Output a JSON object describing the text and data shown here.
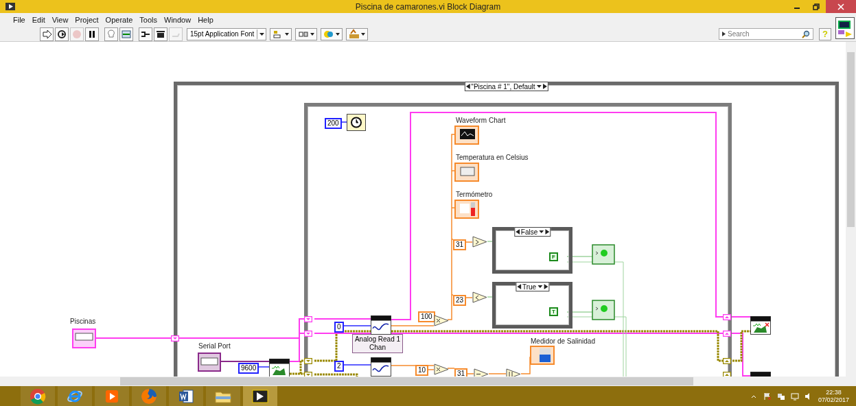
{
  "window": {
    "title": "Piscina de camarones.vi Block Diagram"
  },
  "menu": [
    "File",
    "Edit",
    "View",
    "Project",
    "Operate",
    "Tools",
    "Window",
    "Help"
  ],
  "toolbar": {
    "buttons": [
      {
        "kind": "run",
        "disabled": false
      },
      {
        "kind": "run_continuously",
        "disabled": false
      },
      {
        "kind": "abort",
        "disabled": true
      },
      {
        "kind": "pause",
        "disabled": false
      },
      {
        "kind": "highlight",
        "disabled": false
      },
      {
        "kind": "retain",
        "disabled": false
      },
      {
        "kind": "step_into",
        "disabled": false
      },
      {
        "kind": "step_over",
        "disabled": false
      },
      {
        "kind": "step_out",
        "disabled": true
      }
    ],
    "font": "15pt Application Font",
    "tools": [
      {
        "kind": "align"
      },
      {
        "kind": "distribute"
      },
      {
        "kind": "reorder"
      },
      {
        "kind": "cleanup"
      }
    ],
    "search": {
      "placeholder": "Search"
    },
    "help": "?"
  },
  "diagram": {
    "case_selector": "\"Piscina # 1\", Default",
    "labels": [
      "Waveform Chart",
      "Temperatura en Celsius",
      "Termómetro",
      "Piscinas",
      "Serial Port",
      "Medidor de Salinidad"
    ],
    "constants": [
      {
        "value": "200",
        "kind": "integer"
      },
      {
        "value": "9600",
        "kind": "integer"
      },
      {
        "value": "0",
        "kind": "integer"
      },
      {
        "value": "2",
        "kind": "integer"
      },
      {
        "value": "31",
        "kind": "double"
      },
      {
        "value": "23",
        "kind": "double"
      },
      {
        "value": "100",
        "kind": "double"
      },
      {
        "value": "10",
        "kind": "double"
      },
      {
        "value": "31",
        "kind": "double"
      }
    ],
    "cases": [
      {
        "selector": "False",
        "output": "F"
      },
      {
        "selector": "True",
        "output": "T"
      }
    ],
    "poly_selector": "Analog Read 1 Chan"
  },
  "taskbar": {
    "apps": [
      {
        "kind": "chrome",
        "selected": false
      },
      {
        "kind": "ie",
        "selected": false
      },
      {
        "kind": "media",
        "selected": false
      },
      {
        "kind": "firefox",
        "selected": false
      },
      {
        "kind": "word",
        "selected": false
      },
      {
        "kind": "files",
        "selected": false
      },
      {
        "kind": "labview",
        "selected": true
      }
    ],
    "time": "22:38",
    "date": "07/02/2017"
  }
}
